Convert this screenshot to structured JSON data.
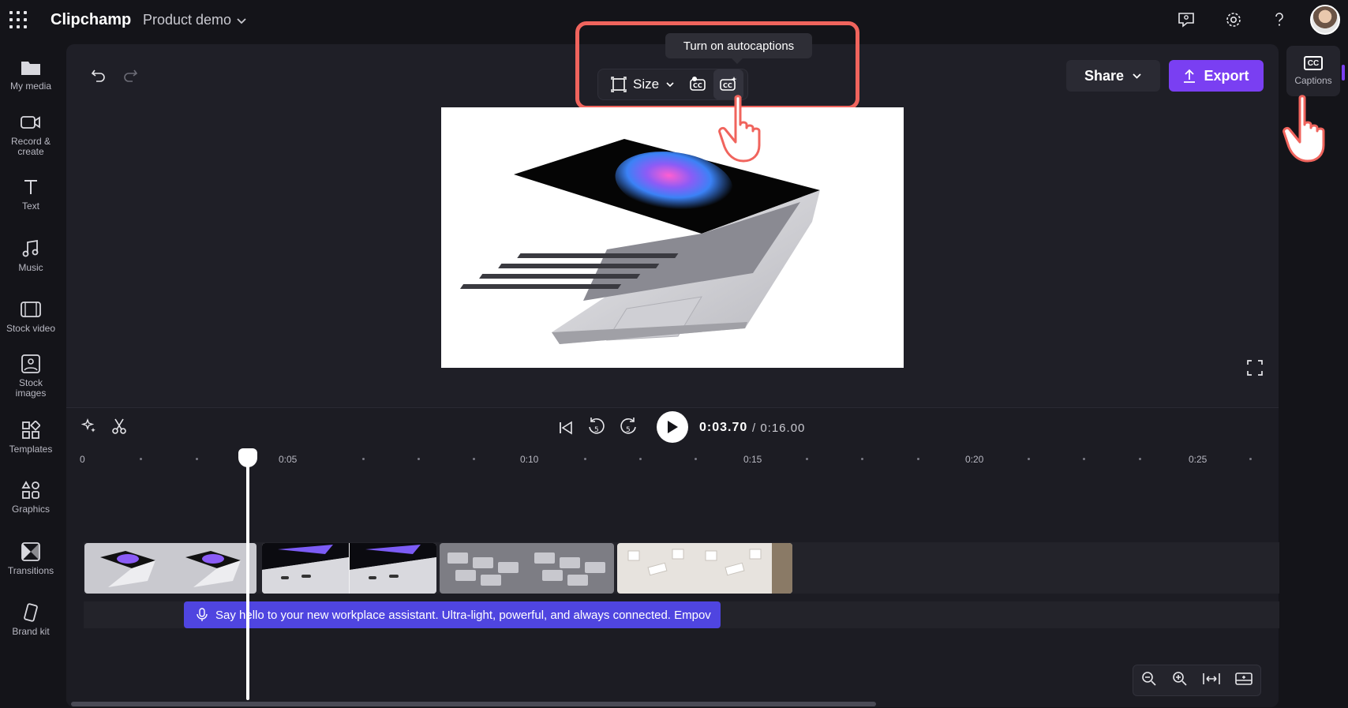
{
  "app": {
    "brand": "Clipchamp",
    "project_name": "Product demo"
  },
  "topbar_icons": [
    "apps-grid-icon",
    "feedback-icon",
    "settings-icon",
    "help-icon",
    "avatar"
  ],
  "rail": {
    "items": [
      {
        "label": "My media",
        "icon": "folder-icon"
      },
      {
        "label": "Record & create",
        "icon": "camera-icon"
      },
      {
        "label": "Text",
        "icon": "text-icon"
      },
      {
        "label": "Music",
        "icon": "music-icon"
      },
      {
        "label": "Stock video",
        "icon": "film-icon"
      },
      {
        "label": "Stock images",
        "icon": "image-icon"
      },
      {
        "label": "Templates",
        "icon": "templates-icon"
      },
      {
        "label": "Graphics",
        "icon": "graphics-icon"
      },
      {
        "label": "Transitions",
        "icon": "transitions-icon"
      },
      {
        "label": "Brand kit",
        "icon": "brand-kit-icon"
      }
    ]
  },
  "toolbar": {
    "size_label": "Size",
    "tooltip": "Turn on autocaptions",
    "share_label": "Share",
    "export_label": "Export"
  },
  "captions_panel": {
    "icon_text": "CC",
    "label": "Captions"
  },
  "playback": {
    "current_time": "0:03.70",
    "total_time": "/ 0:16.00",
    "skip_back_seconds": "5",
    "skip_forward_seconds": "5"
  },
  "ruler": {
    "labels": [
      "0",
      "0:05",
      "0:10",
      "0:15",
      "0:20",
      "0:25"
    ]
  },
  "caption_track": {
    "text": "Say hello to your new workplace assistant. Ultra-light, powerful, and always connected. Empov"
  },
  "colors": {
    "accent": "#7a3ff2",
    "highlight": "#f0645d",
    "caption_clip": "#4f45e0",
    "background": "#141419",
    "panel": "#1f1f27"
  }
}
